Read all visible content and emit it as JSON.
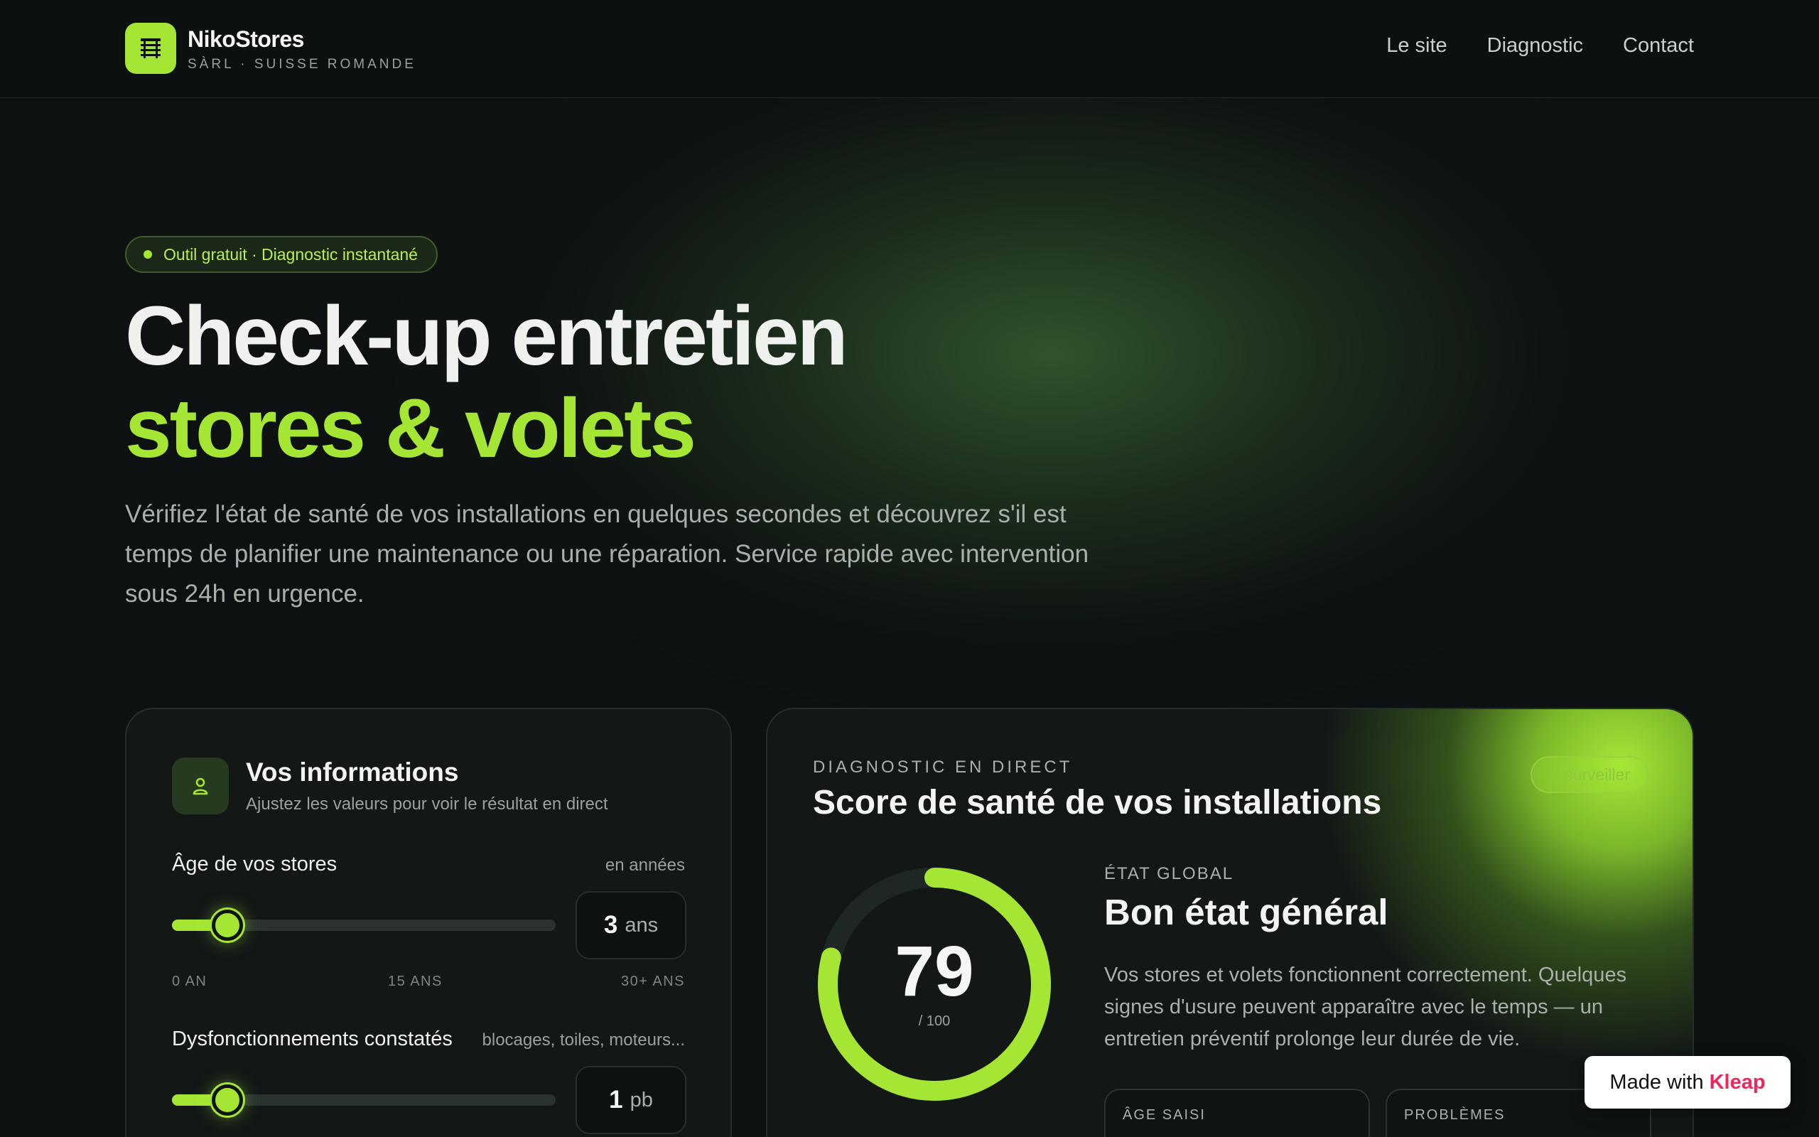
{
  "header": {
    "brand_name": "NikoStores",
    "brand_sub": "SÀRL · SUISSE ROMANDE",
    "logo_icon": "store-shutter-icon",
    "nav": [
      {
        "label": "Le site"
      },
      {
        "label": "Diagnostic"
      },
      {
        "label": "Contact"
      }
    ]
  },
  "hero": {
    "pill": "Outil gratuit · Diagnostic instantané",
    "title_line1": "Check-up entretien",
    "title_line2": "stores & volets",
    "lead": "Vérifiez l'état de santé de vos installations en quelques secondes et découvrez s'il est temps de planifier une maintenance ou une réparation. Service rapide avec intervention sous 24h en urgence."
  },
  "info_card": {
    "icon": "user-icon",
    "title": "Vos informations",
    "subtitle": "Ajustez les valeurs pour voir le résultat en direct",
    "age": {
      "label": "Âge de vos stores",
      "hint": "en années",
      "value": "3",
      "unit": "ans",
      "slider_fraction": 0.1,
      "ticks": [
        "0 AN",
        "15 ANS",
        "30+ ANS"
      ]
    },
    "issues": {
      "label": "Dysfonctionnements constatés",
      "hint": "blocages, toiles, moteurs...",
      "value": "1",
      "unit": "pb",
      "slider_fraction": 0.1
    }
  },
  "score_card": {
    "eyebrow": "DIAGNOSTIC EN DIRECT",
    "title": "Score de santé de vos installations",
    "badge": "À surveiller",
    "score": "79",
    "score_max": "/ 100",
    "score_fraction": 0.79,
    "state_eyebrow": "ÉTAT GLOBAL",
    "state_title": "Bon état général",
    "state_text": "Vos stores et volets fonctionnent correctement. Quelques signes d'usure peuvent apparaître avec le temps — un entretien préventif prolonge leur durée de vie.",
    "mini_labels": [
      "ÂGE SAISI",
      "PROBLÈMES"
    ]
  },
  "watermark": {
    "text": "Made with",
    "brand": "Kleap"
  },
  "colors": {
    "accent": "#a5e635",
    "background": "#0e1111",
    "card": "#131817"
  }
}
